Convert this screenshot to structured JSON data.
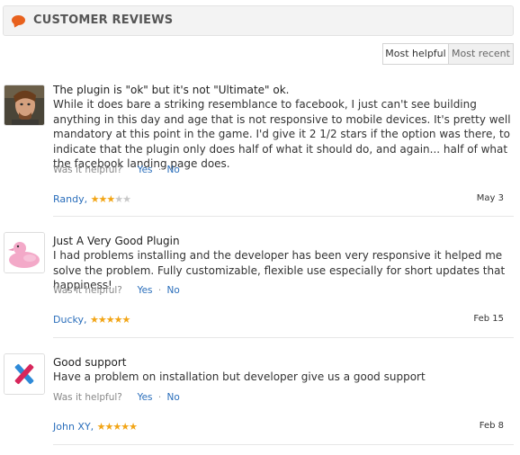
{
  "header": {
    "title": "CUSTOMER REVIEWS",
    "icon": "speech-bubble-icon",
    "icon_color": "#e8611d"
  },
  "sort": {
    "most_helpful": "Most helpful",
    "most_recent": "Most recent"
  },
  "reviews": [
    {
      "title": "The plugin is \"ok\" but it's not \"Ultimate\" ok.",
      "body": "While it does bare a striking resemblance to facebook, I just can't see building anything in this day and age that is not responsive to mobile devices. It's pretty well mandatory at this point in the game. I'd give it 2 1/2 stars if the option was there, to indicate that the plugin only does half of what it should do, and again... half of what the facebook landing page does.",
      "helpful_label": "Was it helpful?",
      "yes": "Yes",
      "no": "No",
      "author": "Randy,",
      "rating": 3,
      "rating_max": 5,
      "date": "May 3",
      "avatar": "person-photo"
    },
    {
      "title": "Just A Very Good Plugin",
      "body": "I had problems installing and the developer has been very responsive it helped me solve the problem. Fully customizable, flexible use especially for short updates that happiness!",
      "helpful_label": "Was it helpful?",
      "yes": "Yes",
      "no": "No",
      "author": "Ducky,",
      "rating": 5,
      "rating_max": 5,
      "date": "Feb 15",
      "avatar": "pink-duck"
    },
    {
      "title": "Good support",
      "body": "Have a problem on installation but developer give us a good support",
      "helpful_label": "Was it helpful?",
      "yes": "Yes",
      "no": "No",
      "author": "John XY,",
      "rating": 5,
      "rating_max": 5,
      "date": "Feb 8",
      "avatar": "cross-logo"
    }
  ]
}
